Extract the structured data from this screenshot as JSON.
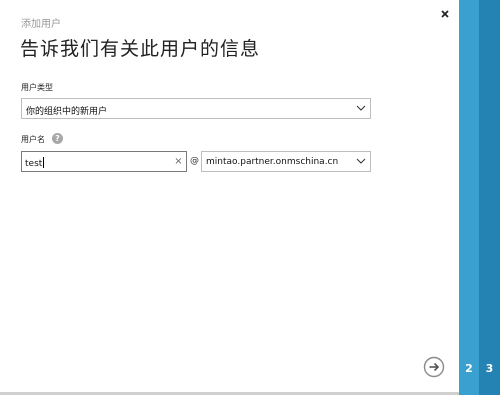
{
  "dialog": {
    "subtitle": "添加用户",
    "title": "告诉我们有关此用户的信息",
    "close_icon": "close-x-icon"
  },
  "user_type": {
    "label": "用户类型",
    "selected_value": "你的组织中的新用户"
  },
  "user_name": {
    "label": "用户名",
    "help_icon": "?",
    "value": "test",
    "clear_icon": "×",
    "at_sign": "@",
    "domain_selected": "mintao.partner.onmschina.cn"
  },
  "navigation": {
    "next_icon": "arrow-right-circle-icon"
  },
  "steps": [
    {
      "number": "2"
    },
    {
      "number": "3"
    }
  ],
  "colors": {
    "step_2": "#3aa0cf",
    "step_3": "#2483b2",
    "input_border_active": "#7a7a7a",
    "select_border": "#bdbdbd"
  }
}
